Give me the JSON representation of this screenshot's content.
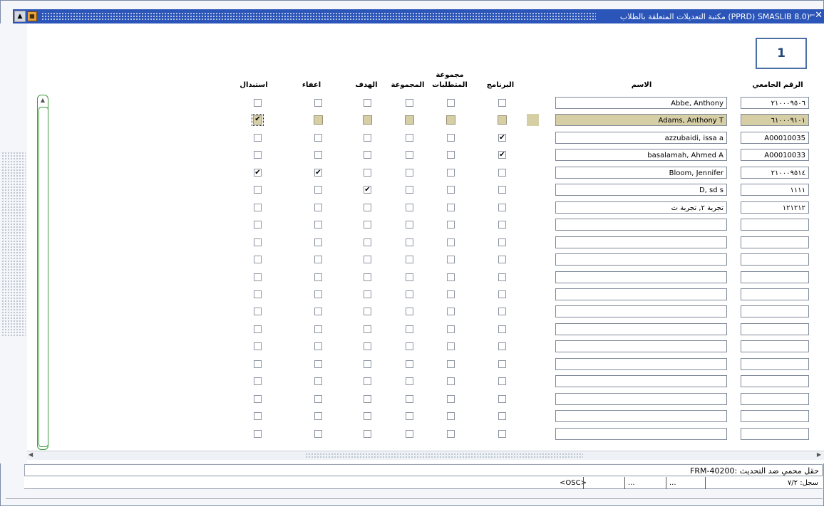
{
  "window": {
    "title": "مكتبة التعديلات المتعلقة بالطلاب  (PPRD)  SMASLIB 8.0)",
    "close_glyph": "✕",
    "restore_glyph": "⌐",
    "menu_glyph": "▲",
    "app_icon_glyph": "▦"
  },
  "callout_label": "1",
  "headers": {
    "id": "الرقم الجامعي",
    "name": "الاسم",
    "program": "البرنامج",
    "req_group_line1": "مجموعة",
    "req_group_line2": "المتطلبات",
    "group": "المجموعة",
    "target": "الهدف",
    "waiver": "اعفاء",
    "substitution": "استبدال"
  },
  "rows": [
    {
      "id": "٢١٠٠٠٩٥٠٦",
      "name": "Abbe, Anthony",
      "program": false,
      "req_group": false,
      "group": false,
      "target": false,
      "waiver": false,
      "substitution": false
    },
    {
      "id": "٦١٠٠٠٩١٠١",
      "name": "Adams, Anthony T",
      "program": false,
      "req_group": false,
      "group": false,
      "target": false,
      "waiver": false,
      "substitution": true,
      "selected": true
    },
    {
      "id": "A00010035",
      "name": "azzubaidi, issa a",
      "program": true,
      "req_group": false,
      "group": false,
      "target": false,
      "waiver": false,
      "substitution": false
    },
    {
      "id": "A00010033",
      "name": "basalamah, Ahmed A",
      "program": true,
      "req_group": false,
      "group": false,
      "target": false,
      "waiver": false,
      "substitution": false
    },
    {
      "id": "٢١٠٠٠٩٥١٤",
      "name": "Bloom, Jennifer",
      "program": false,
      "req_group": false,
      "group": false,
      "target": false,
      "waiver": true,
      "substitution": true
    },
    {
      "id": "١١١١",
      "name": "D, sd s",
      "program": false,
      "req_group": false,
      "group": false,
      "target": true,
      "waiver": false,
      "substitution": false
    },
    {
      "id": "١٢١٢١٢",
      "name": "تجربة ٢, تجربة ت",
      "program": false,
      "req_group": false,
      "group": false,
      "target": false,
      "waiver": false,
      "substitution": false
    },
    {
      "id": "",
      "name": ""
    },
    {
      "id": "",
      "name": ""
    },
    {
      "id": "",
      "name": ""
    },
    {
      "id": "",
      "name": ""
    },
    {
      "id": "",
      "name": ""
    },
    {
      "id": "",
      "name": ""
    },
    {
      "id": "",
      "name": ""
    },
    {
      "id": "",
      "name": ""
    },
    {
      "id": "",
      "name": ""
    },
    {
      "id": "",
      "name": ""
    },
    {
      "id": "",
      "name": ""
    },
    {
      "id": "",
      "name": ""
    },
    {
      "id": "",
      "name": ""
    }
  ],
  "status": {
    "message": "FRM-40200: حقل محمي ضد التحديث",
    "record": "سجل: ٧/٢",
    "osc": "<OSC>",
    "seg1": "...",
    "seg2": "..."
  },
  "checkmark_glyph": "✔"
}
